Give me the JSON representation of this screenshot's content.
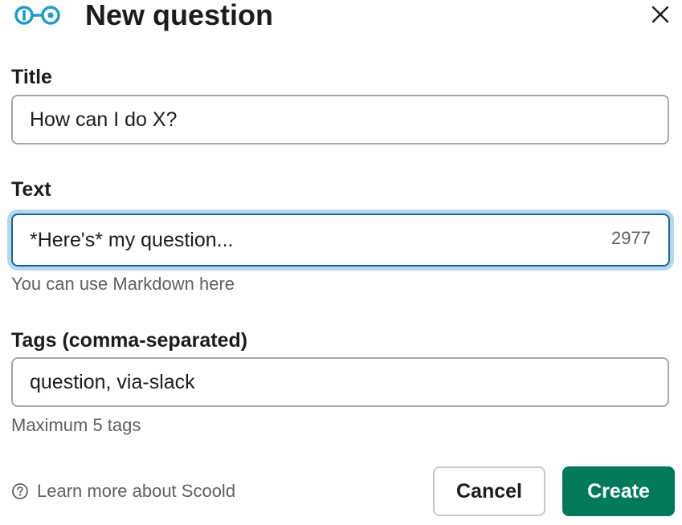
{
  "modal": {
    "title": "New question",
    "logo_icon": "scoold-logo-icon",
    "close_icon": "close-icon"
  },
  "fields": {
    "title": {
      "label": "Title",
      "value": "How can I do X?"
    },
    "text": {
      "label": "Text",
      "value": "*Here's* my question...",
      "char_count": "2977",
      "hint": "You can use Markdown here"
    },
    "tags": {
      "label": "Tags (comma-separated)",
      "value": "question, via-slack",
      "hint": "Maximum 5 tags"
    }
  },
  "footer": {
    "help_icon": "question-circle-icon",
    "help_text": "Learn more about Scoold",
    "cancel_label": "Cancel",
    "create_label": "Create"
  },
  "colors": {
    "primary": "#007a5a",
    "focus_border": "#1264a3",
    "focus_glow": "#b6d9ea",
    "logo": "#1d9bd1"
  }
}
